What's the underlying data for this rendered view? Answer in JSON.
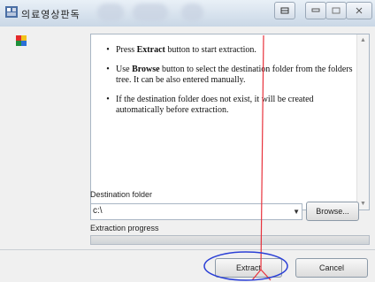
{
  "window": {
    "title": "의료영상판독",
    "app_icon": "app-logo-icon"
  },
  "content_icon": "multicolor-logo-icon",
  "instructions": [
    {
      "prefix": "Press ",
      "bold": "Extract",
      "suffix": " button to start extraction."
    },
    {
      "prefix": "Use ",
      "bold": "Browse",
      "suffix": " button to select the destination folder from the folders tree. It can be also entered manually."
    },
    {
      "prefix": "",
      "bold": "",
      "suffix": "If the destination folder does not exist, it will be created automatically before extraction."
    }
  ],
  "destination": {
    "label": "Destination folder",
    "value": "c:\\",
    "browse_label": "Browse..."
  },
  "progress": {
    "label": "Extraction progress",
    "value": 0
  },
  "buttons": {
    "extract": "Extract",
    "cancel": "Cancel"
  },
  "colors": {
    "annotation_arrow": "#e8323c",
    "annotation_circle": "#2a3fd6"
  }
}
